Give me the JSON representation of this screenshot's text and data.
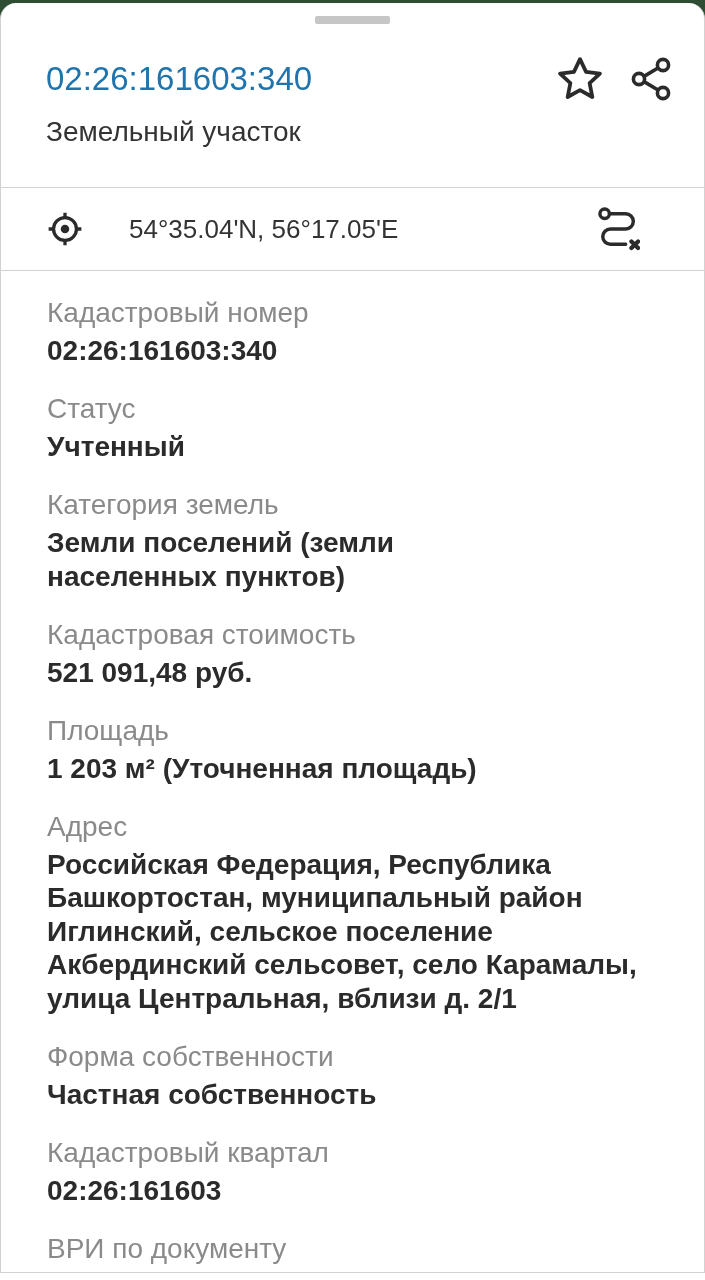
{
  "header": {
    "title": "02:26:161603:340",
    "subtitle": "Земельный участок",
    "starred": false
  },
  "location": {
    "coordinates": "54°35.04'N, 56°17.05'E"
  },
  "fields": [
    {
      "label": "Кадастровый номер",
      "value": "02:26:161603:340"
    },
    {
      "label": "Статус",
      "value": "Учтенный"
    },
    {
      "label": "Категория земель",
      "value": "Земли поселений (земли\nнаселенных пунктов)"
    },
    {
      "label": "Кадастровая стоимость",
      "value": "521 091,48 руб."
    },
    {
      "label": "Площадь",
      "value": "1 203 м² (Уточненная площадь)"
    },
    {
      "label": "Адрес",
      "value": "Российская Федерация, Республика Башкортостан, муниципальный район Иглинский, сельское поселение Акбердинский сельсовет, село Карамалы, улица Центральная, вблизи д. 2/1"
    },
    {
      "label": "Форма собственности",
      "value": "Частная собственность"
    },
    {
      "label": "Кадастровый квартал",
      "value": "02:26:161603"
    },
    {
      "label": "ВРИ по документу"
    }
  ]
}
